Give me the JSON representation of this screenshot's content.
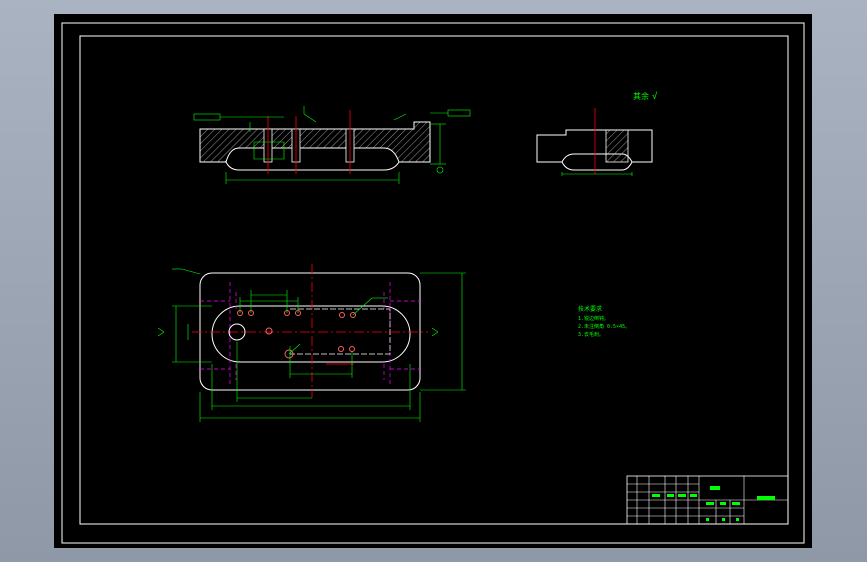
{
  "window": {
    "title": ""
  },
  "drawing": {
    "sheet": "A3",
    "colors": {
      "background": "#000000",
      "border": "#ffffff",
      "geometry": "#ffffff",
      "dimension": "#00ff00",
      "centerline": "#ff0000",
      "hidden": "#ff00ff",
      "hole": "#ff6060",
      "hatch": "#ffffff"
    },
    "section_view": {
      "title": "",
      "detail_note": ""
    },
    "plan_view": {
      "tag_label": "",
      "detail_label": ""
    },
    "roughness_note": {
      "text": "其余",
      "symbol": "√"
    },
    "tech_requirements": {
      "heading": "技术要求",
      "lines": [
        "1.锐边倒钝。",
        "2.未注倒角 0.5×45。",
        "3.去毛刺。"
      ]
    },
    "title_block": {
      "part_name": "",
      "drawing_no": "",
      "material": "",
      "scale": "",
      "sheet": ""
    }
  }
}
